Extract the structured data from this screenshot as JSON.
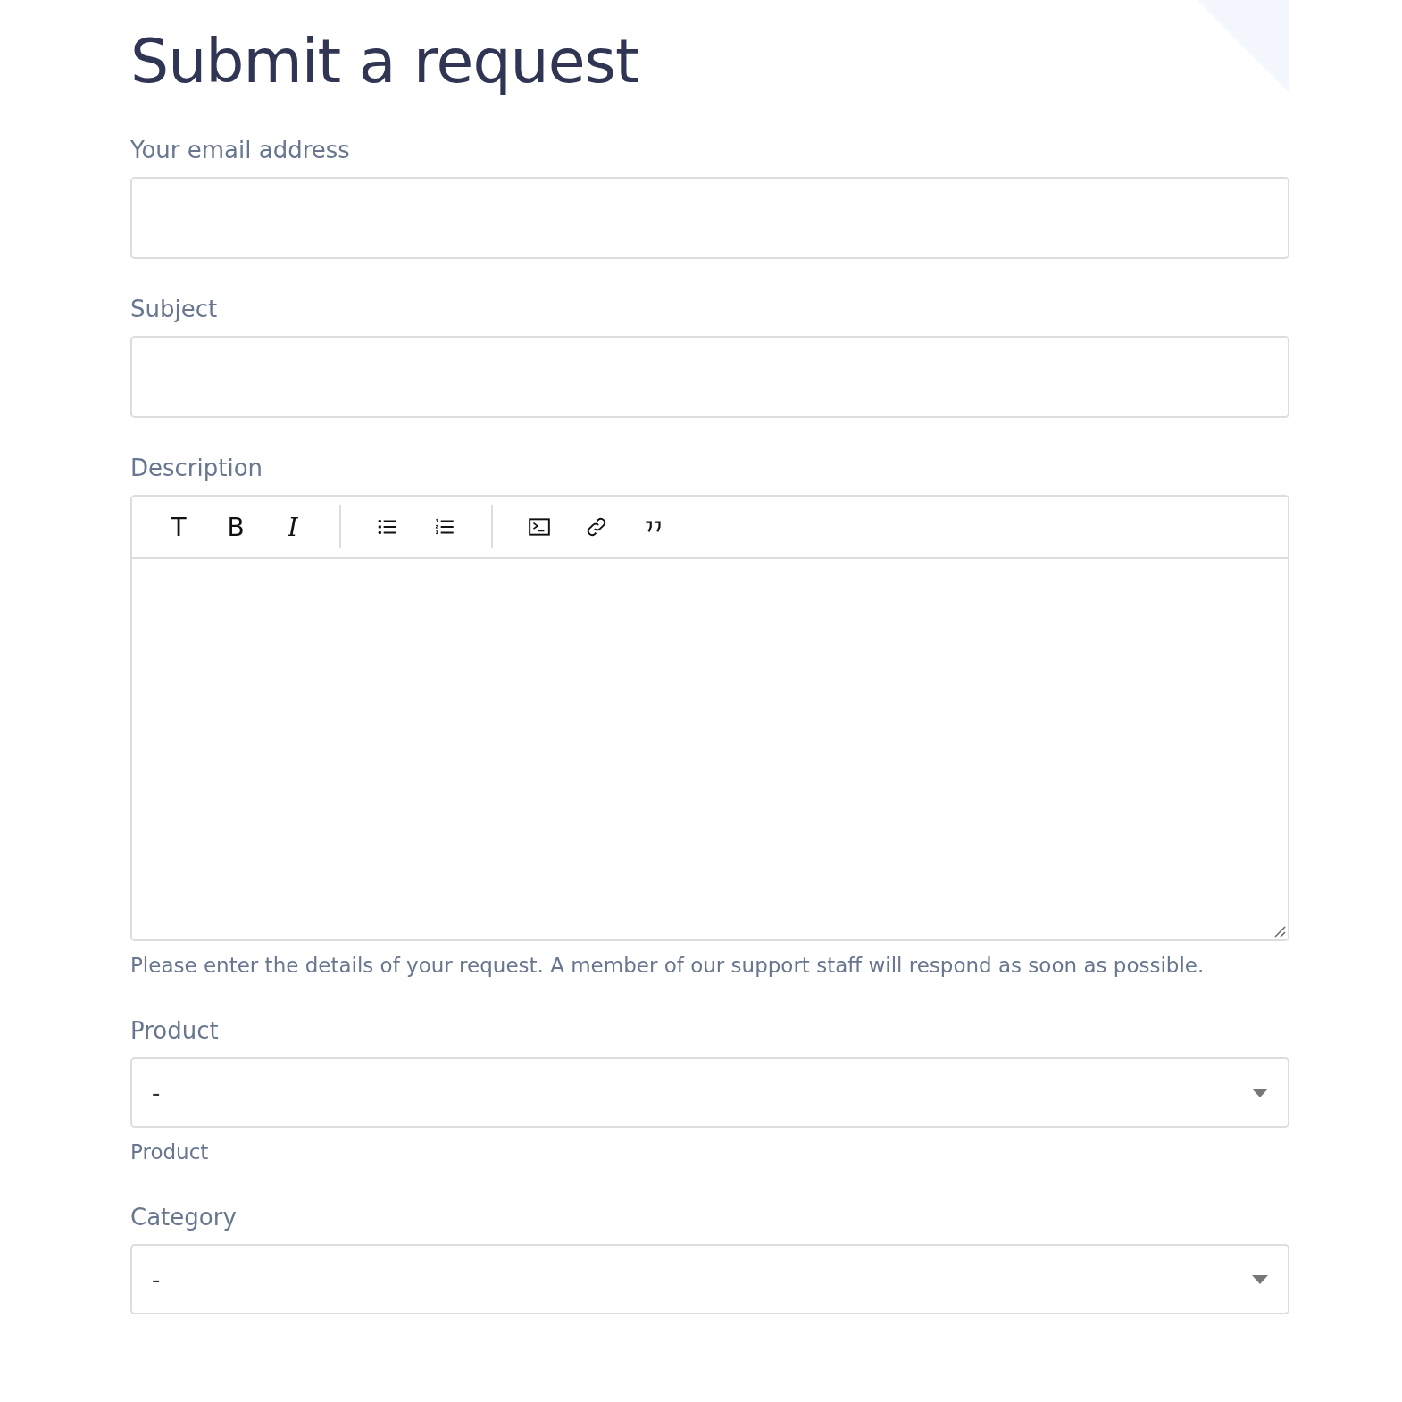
{
  "title": "Submit a request",
  "fields": [
    {
      "kind": "text",
      "label": "Your email address"
    },
    {
      "kind": "text",
      "label": "Subject"
    },
    {
      "kind": "editor",
      "label": "Description",
      "toolbar": [
        [
          {
            "kind": "text",
            "glyph": "T"
          },
          {
            "kind": "bold",
            "glyph": "B"
          },
          {
            "kind": "italic",
            "glyph": "I"
          }
        ],
        [
          {
            "kind": "bullets"
          },
          {
            "kind": "numbers"
          }
        ],
        [
          {
            "kind": "code"
          },
          {
            "kind": "link"
          },
          {
            "kind": "quote"
          }
        ]
      ],
      "hint": "Please enter the details of your request. A member of our support staff will respond as soon as possible."
    },
    {
      "kind": "select",
      "label": "Product",
      "value": "-",
      "hint": "Product"
    },
    {
      "kind": "select",
      "label": "Category",
      "value": "-"
    }
  ]
}
